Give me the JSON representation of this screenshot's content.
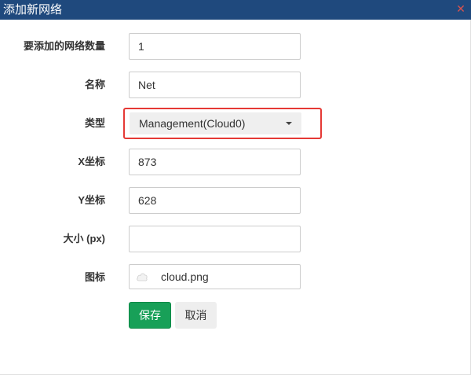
{
  "dialog": {
    "title": "添加新网络",
    "close_glyph": "✕"
  },
  "form": {
    "count": {
      "label": "要添加的网络数量",
      "value": "1"
    },
    "name": {
      "label": "名称",
      "value": "Net"
    },
    "type": {
      "label": "类型",
      "selected": "Management(Cloud0)"
    },
    "x": {
      "label": "X坐标",
      "value": "873"
    },
    "y": {
      "label": "Y坐标",
      "value": "628"
    },
    "size": {
      "label": "大小 (px)",
      "value": ""
    },
    "icon": {
      "label": "图标",
      "value": "cloud.png",
      "icon_name": "cloud-icon"
    }
  },
  "buttons": {
    "save": "保存",
    "cancel": "取消"
  },
  "colors": {
    "titlebar": "#1f497d",
    "save": "#18a058",
    "highlight": "#e53935"
  }
}
